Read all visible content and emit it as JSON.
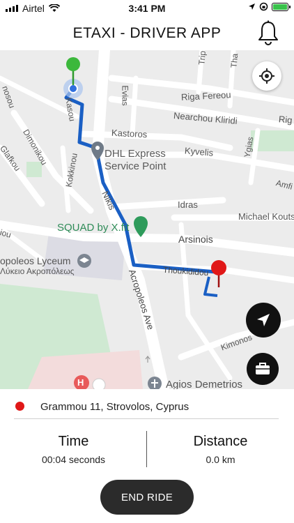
{
  "status_bar": {
    "carrier": "Airtel",
    "time": "3:41 PM",
    "battery_level": 1.0
  },
  "header": {
    "title": "ETAXI - DRIVER APP"
  },
  "map": {
    "streets": [
      "Riga Fereou",
      "Nearchou Kliridi",
      "Kastoros",
      "Kyvelis",
      "Evias",
      "Ygias",
      "Amfi",
      "Kasou",
      "Dimonikou",
      "Glafkou",
      "Kokkinou",
      "Nikis",
      "Idras",
      "Michael Kouts",
      "Arsinois",
      "Thoukididou",
      "Acropoleos Ave",
      "Kimonos",
      "nosou",
      "Rig",
      "Trip",
      "Tha",
      "iou"
    ],
    "places": {
      "dhl_line1": "DHL Express",
      "dhl_line2": "Service Point",
      "squad": "SQUAD by X.fit",
      "lyceum_line1": "opoleos Lyceum",
      "lyceum_line2": "Λύκειο Ακροπόλεως",
      "agios": "Agios Demetrios",
      "hospital_letter": "H"
    },
    "colors": {
      "route": "#1a5fc4",
      "start_pin": "#3cb83c",
      "destination_pin": "#e01818",
      "park": "#cfe9d2",
      "road": "#ffffff"
    }
  },
  "ride": {
    "destination": "Grammou 11, Strovolos, Cyprus",
    "time_label": "Time",
    "time_value": "00:04 seconds",
    "distance_label": "Distance",
    "distance_value": "0.0 km"
  },
  "actions": {
    "end_ride": "END RIDE"
  }
}
